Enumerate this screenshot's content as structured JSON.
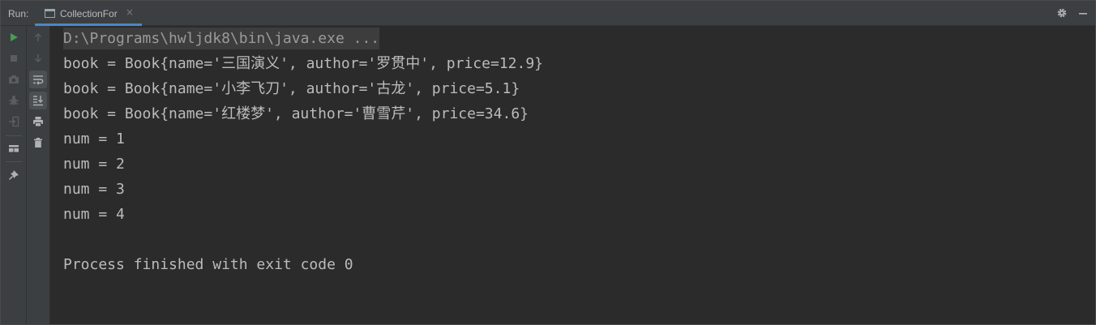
{
  "header": {
    "run_label": "Run:",
    "tab_label": "CollectionFor",
    "tab_close": "×"
  },
  "toolbar": {
    "buttons": [
      {
        "name": "rerun-icon"
      },
      {
        "name": "stop-icon"
      },
      {
        "name": "camera-icon"
      },
      {
        "name": "debug-bug-icon"
      },
      {
        "name": "exit-login-icon"
      },
      {
        "name": "layout-icon"
      },
      {
        "name": "pin-icon"
      },
      {
        "name": "up-arrow-icon"
      },
      {
        "name": "down-arrow-icon"
      },
      {
        "name": "soft-wrap-icon"
      },
      {
        "name": "scroll-to-end-icon"
      },
      {
        "name": "print-icon"
      },
      {
        "name": "trash-icon"
      }
    ]
  },
  "console": {
    "command": "D:\\Programs\\hwljdk8\\bin\\java.exe ...",
    "lines": [
      "book = Book{name='三国演义', author='罗贯中', price=12.9}",
      "book = Book{name='小李飞刀', author='古龙', price=5.1}",
      "book = Book{name='红楼梦', author='曹雪芹', price=34.6}",
      "num = 1",
      "num = 2",
      "num = 3",
      "num = 4",
      "",
      "Process finished with exit code 0"
    ]
  },
  "colors": {
    "background": "#2b2b2b",
    "panel": "#3c3f41",
    "text": "#bbbbbb",
    "run_green": "#499c54",
    "tab_underline": "#4a88c7"
  }
}
